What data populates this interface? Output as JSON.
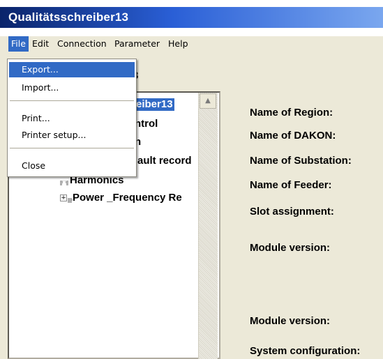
{
  "window": {
    "title": "Qualitätsschreiber13"
  },
  "menubar": {
    "items": [
      "File",
      "Edit",
      "Connection",
      "Parameter",
      "Help"
    ]
  },
  "file_menu": {
    "items": [
      {
        "label": "Export..."
      },
      {
        "label": "Import..."
      },
      {
        "label": "Print..."
      },
      {
        "label": "Printer setup..."
      },
      {
        "label": "Close"
      }
    ]
  },
  "header": {
    "partial_title": "3"
  },
  "tree": {
    "root_label": "eiber13",
    "items": [
      {
        "label": "ntrol"
      },
      {
        "label": "n"
      },
      {
        "label": "ault record"
      },
      {
        "label": "Harmonics"
      },
      {
        "label": "Power _Frequency Re"
      }
    ],
    "expander_symbol": "+"
  },
  "details": {
    "labels": [
      "Name of Region:",
      "Name of DAKON:",
      "Name of Substation:",
      "Name of Feeder:",
      "Slot assignment:",
      "Module version:",
      "Module version:",
      "System configuration:"
    ]
  },
  "icons": {
    "scroll_up": "scroll-up-arrow-icon",
    "expander": "plus-expander-icon"
  }
}
